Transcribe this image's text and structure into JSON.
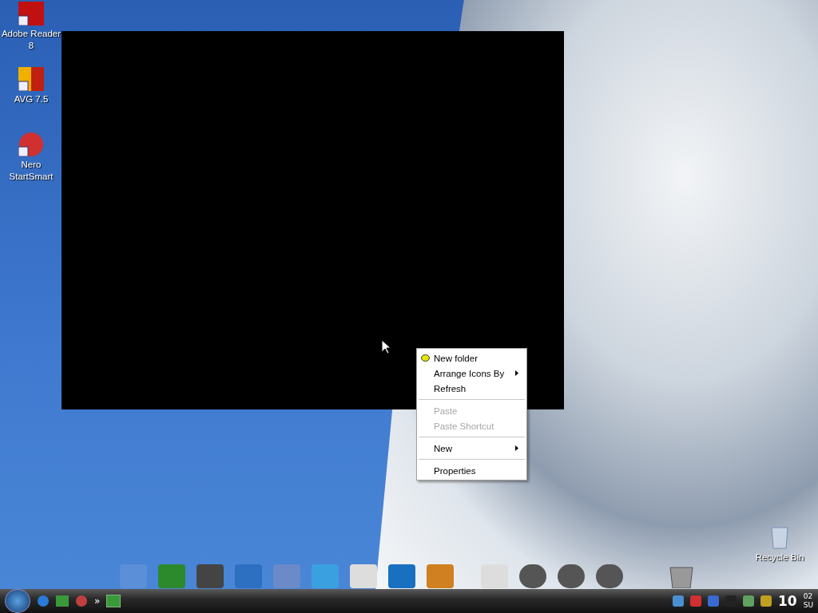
{
  "desktop_icons": [
    {
      "label": "Adobe Reader 8",
      "kind": "reader"
    },
    {
      "label": "AVG 7.5",
      "kind": "avg"
    },
    {
      "label": "Nero StartSmart",
      "kind": "nero"
    }
  ],
  "recycle_bin": {
    "label": "Recycle Bin"
  },
  "context_menu": {
    "items": [
      {
        "kind": "item",
        "label": "New folder",
        "disabled": false,
        "has_submenu": false,
        "has_icon": true
      },
      {
        "kind": "item",
        "label": "Arrange Icons By",
        "disabled": false,
        "has_submenu": true,
        "has_icon": false
      },
      {
        "kind": "item",
        "label": "Refresh",
        "disabled": false,
        "has_submenu": false,
        "has_icon": false
      },
      {
        "kind": "separator"
      },
      {
        "kind": "item",
        "label": "Paste",
        "disabled": true,
        "has_submenu": false,
        "has_icon": false
      },
      {
        "kind": "item",
        "label": "Paste Shortcut",
        "disabled": true,
        "has_submenu": false,
        "has_icon": false
      },
      {
        "kind": "separator"
      },
      {
        "kind": "item",
        "label": "New",
        "disabled": false,
        "has_submenu": true,
        "has_icon": false
      },
      {
        "kind": "separator"
      },
      {
        "kind": "item",
        "label": "Properties",
        "disabled": false,
        "has_submenu": false,
        "has_icon": false
      }
    ]
  },
  "taskbar": {
    "overflow": "»",
    "clock": {
      "hour": "10",
      "minute": "02",
      "day": "SU"
    }
  }
}
